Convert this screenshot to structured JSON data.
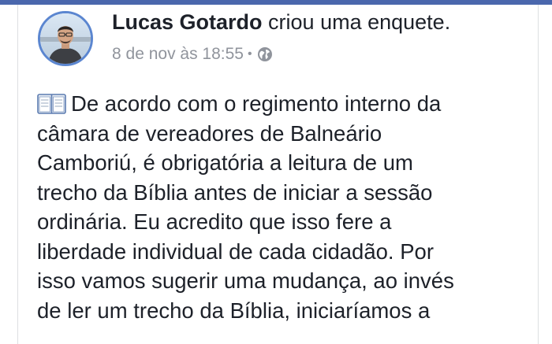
{
  "post": {
    "author_name": "Lucas Gotardo",
    "action_text": "criou uma enquete.",
    "timestamp": "8 de nov às 18:55",
    "separator": "•",
    "privacy_icon": "globe-icon",
    "lead_icon": "open-book-icon",
    "body_lines": [
      "De acordo com o regimento interno da",
      "câmara de vereadores de Balneário",
      "Camboriú, é obrigatória a leitura de um",
      "trecho da Bíblia antes de iniciar a sessão",
      "ordinária. Eu acredito que isso fere a",
      "liberdade individual de cada cidadão. Por",
      "isso vamos sugerir uma mudança, ao invés",
      "de ler um trecho da Bíblia, iniciaríamos a"
    ]
  },
  "colors": {
    "top_band": "#4a67ad",
    "avatar_ring": "#5b86d0",
    "text_primary": "#1d2129",
    "text_secondary": "#90949c"
  }
}
